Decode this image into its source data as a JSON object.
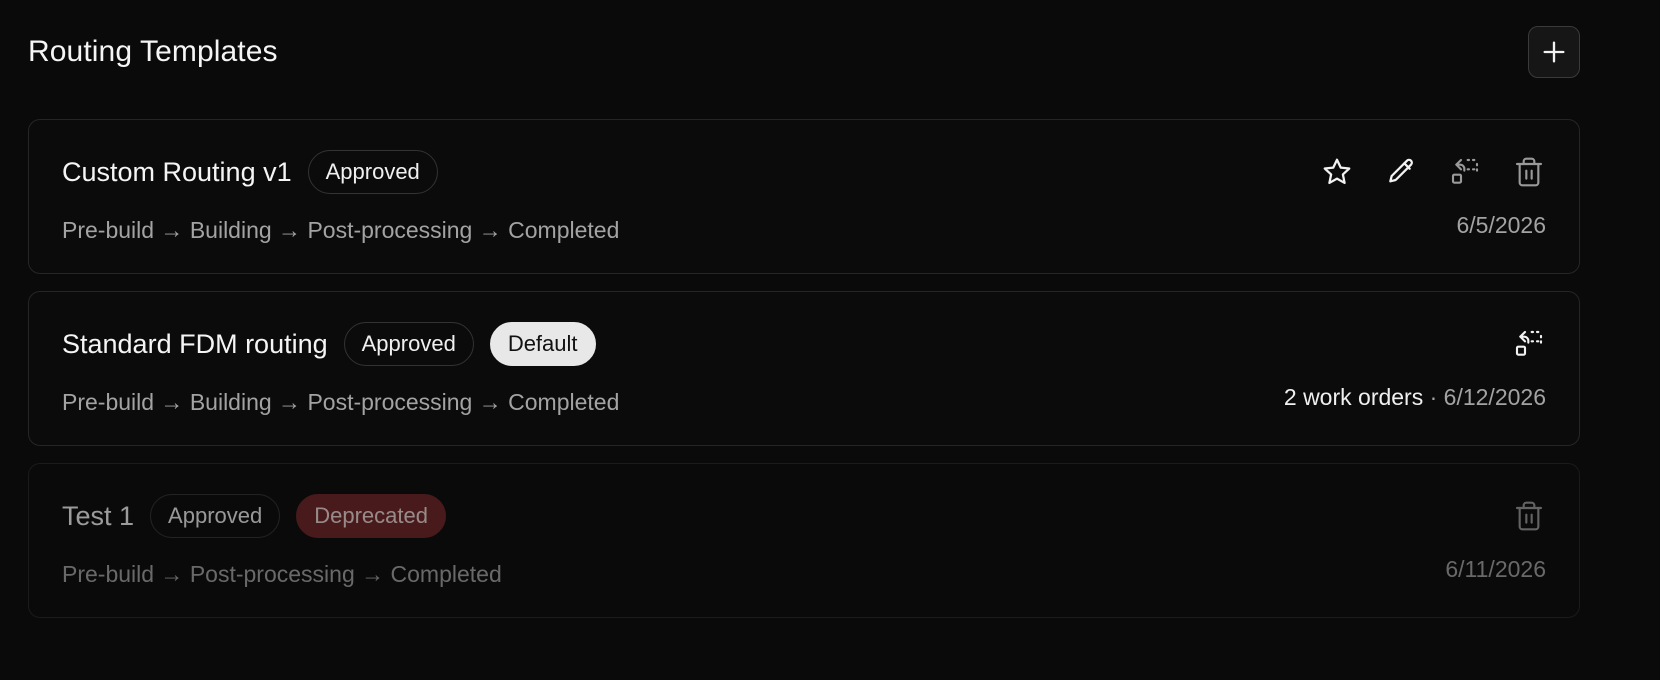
{
  "header": {
    "title": "Routing Templates",
    "add_icon": "plus-icon"
  },
  "templates": [
    {
      "name": "Custom Routing v1",
      "status": "Approved",
      "steps": "Pre-build → Building → Post-processing → Completed",
      "date": "6/5/2026",
      "actions": [
        "star-icon",
        "pencil-icon",
        "convert-icon",
        "trash-icon"
      ]
    },
    {
      "name": "Standard FDM routing",
      "status": "Approved",
      "default_badge": "Default",
      "steps": "Pre-build → Building → Post-processing → Completed",
      "work_orders": "2 work orders",
      "separator": " · ",
      "date": "6/12/2026",
      "actions": [
        "convert-icon"
      ]
    },
    {
      "name": "Test 1",
      "status": "Approved",
      "deprecated_badge": "Deprecated",
      "steps": "Pre-build → Post-processing → Completed",
      "date": "6/11/2026",
      "actions": [
        "trash-icon"
      ]
    }
  ],
  "colors": {
    "background": "#0a0a0a",
    "card_border": "#262626",
    "deprecated": "#6e2527",
    "default_badge": "#e8e8e8"
  }
}
